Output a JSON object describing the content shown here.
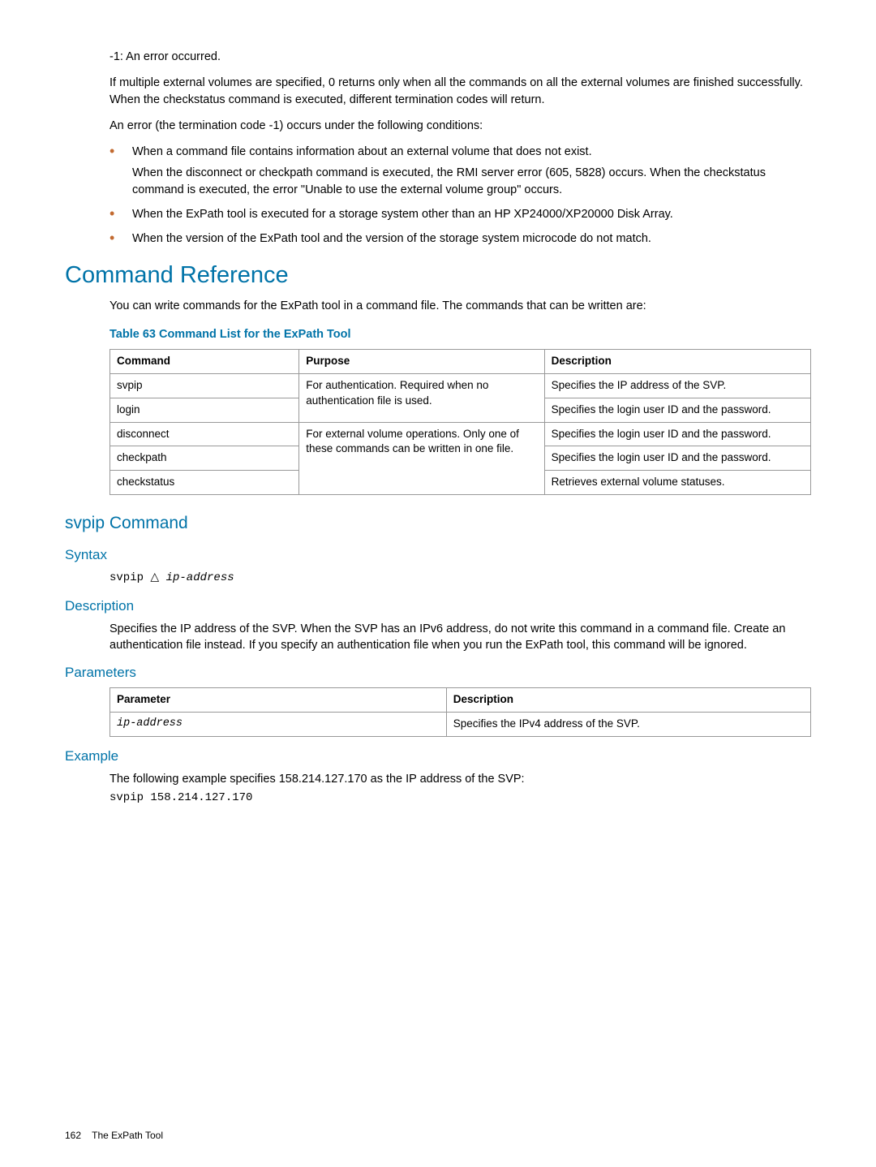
{
  "intro": {
    "line1": "-1: An error occurred.",
    "line2": "If multiple external volumes are specified, 0 returns only when all the commands on all the external volumes are finished successfully. When the checkstatus command is executed, different termination codes will return.",
    "line3": "An error (the termination code -1) occurs under the following conditions:",
    "bullets": [
      {
        "p1": "When a command file contains information about an external volume that does not exist.",
        "p2": "When the disconnect or checkpath command is executed, the RMI server error (605, 5828) occurs. When the checkstatus command is executed, the error \"Unable to use the external volume group\" occurs."
      },
      {
        "p1": "When the ExPath tool is executed for a storage system other than an HP XP24000/XP20000 Disk Array."
      },
      {
        "p1": "When the version of the ExPath tool and the version of the storage system microcode do not match."
      }
    ]
  },
  "command_ref": {
    "heading": "Command Reference",
    "para": "You can write commands for the ExPath tool in a command file. The commands that can be written are:",
    "table_caption": "Table 63 Command List for the ExPath Tool",
    "headers": {
      "c1": "Command",
      "c2": "Purpose",
      "c3": "Description"
    },
    "rows": {
      "r1": {
        "cmd": "svpip",
        "purpose_a": "For authentication. Required when no authentication file is used.",
        "desc": "Specifies the IP address of the SVP."
      },
      "r2": {
        "cmd": "login",
        "desc": "Specifies the login user ID and the password."
      },
      "r3": {
        "cmd": "disconnect",
        "purpose_b": "For external volume operations. Only one of these commands can be written in one file.",
        "desc": "Specifies the login user ID and the password."
      },
      "r4": {
        "cmd": "checkpath",
        "desc": "Specifies the login user ID and the password."
      },
      "r5": {
        "cmd": "checkstatus",
        "desc": "Retrieves external volume statuses."
      }
    }
  },
  "svpip": {
    "heading": "svpip Command",
    "syntax_h": "Syntax",
    "syntax_prefix": "svpip ",
    "syntax_delta": "△",
    "syntax_arg": " ip-address",
    "desc_h": "Description",
    "desc_p": "Specifies the IP address of the SVP. When the SVP has an IPv6 address, do not write this command in a command file. Create an authentication file instead. If you specify an authentication file when you run the ExPath tool, this command will be ignored.",
    "params_h": "Parameters",
    "params_headers": {
      "c1": "Parameter",
      "c2": "Description"
    },
    "params_row": {
      "param": "ip-address",
      "desc": "Specifies the IPv4 address of the SVP."
    },
    "example_h": "Example",
    "example_p": "The following example specifies 158.214.127.170 as the IP address of the SVP:",
    "example_code": "svpip 158.214.127.170"
  },
  "footer": {
    "page": "162",
    "title": "The ExPath Tool"
  }
}
